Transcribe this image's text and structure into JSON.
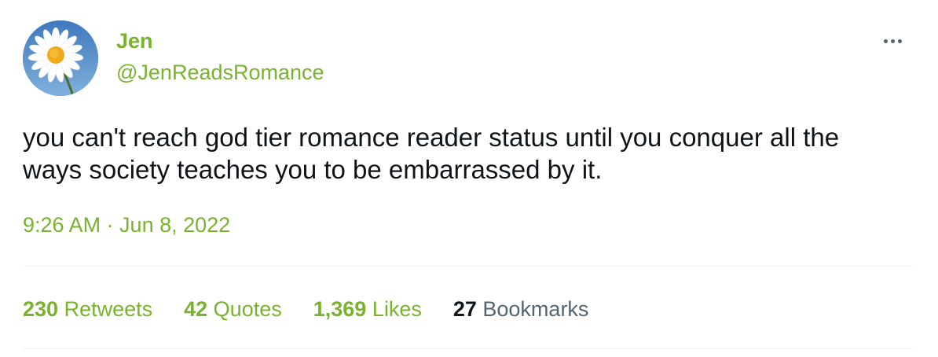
{
  "author": {
    "display_name": "Jen",
    "handle": "@JenReadsRomance"
  },
  "avatar": {
    "icon": "daisy-flower-avatar",
    "sky_color": "#4e87c9",
    "petal_color": "#ffffff",
    "center_color": "#f1a91c"
  },
  "tweet": {
    "text_lines": [
      "you can't reach god tier romance reader status until you conquer all the",
      "ways society teaches you to be embarrassed by it."
    ],
    "timestamp": "9:26 AM · Jun 8, 2022"
  },
  "stats": {
    "retweets": {
      "count": "230",
      "label": "Retweets"
    },
    "quotes": {
      "count": "42",
      "label": "Quotes"
    },
    "likes": {
      "count": "1,369",
      "label": "Likes"
    },
    "bookmarks": {
      "count": "27",
      "label": "Bookmarks"
    }
  },
  "colors": {
    "accent": "#79b22c",
    "text": "#0f1419",
    "muted": "#536471",
    "divider": "#eff3f4"
  },
  "menu": {
    "icon": "more-horizontal-icon"
  }
}
